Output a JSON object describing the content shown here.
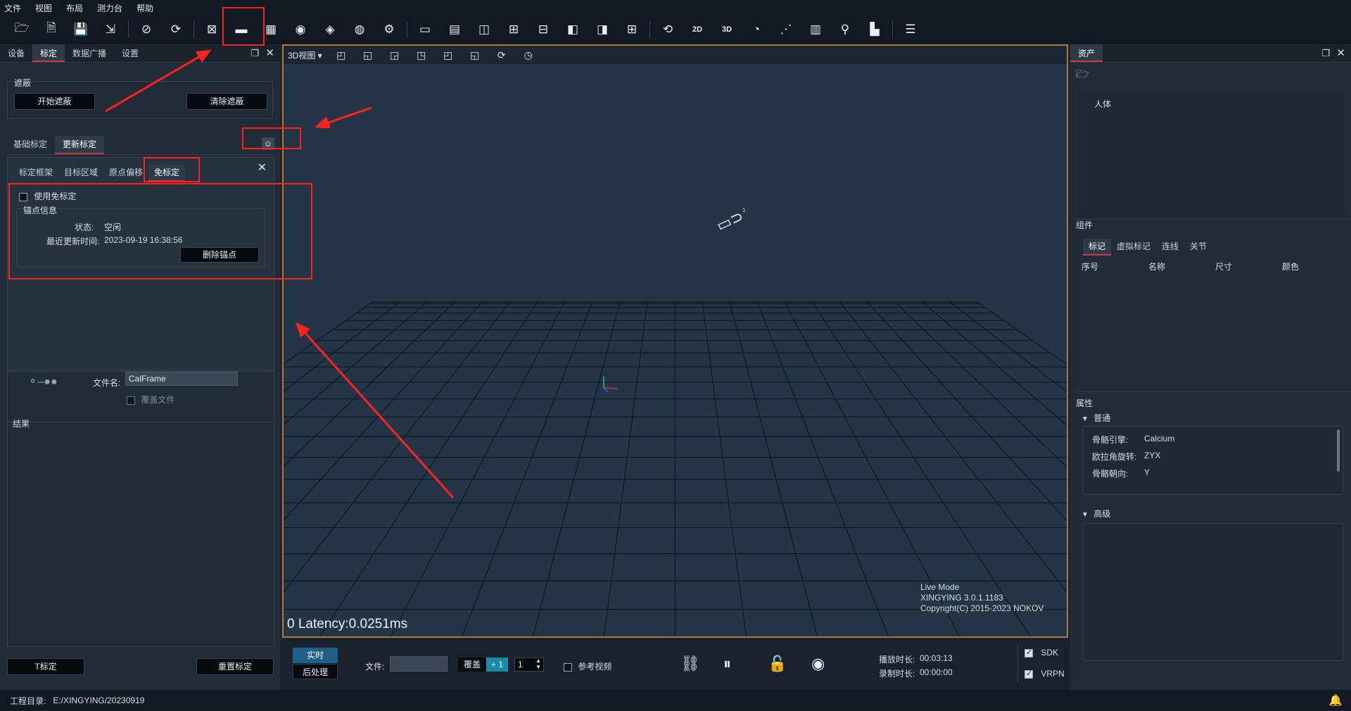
{
  "menu": [
    "文件",
    "视图",
    "布局",
    "测力台",
    "帮助"
  ],
  "toolbar_icons": [
    "open-folder-icon",
    "new-file-icon",
    "save-icon",
    "save-as-icon",
    "hide-icon",
    "refresh-icon",
    "camera-off-icon",
    "ruler-icon",
    "film-icon",
    "rotate-icon",
    "layers-icon",
    "wifi-icon",
    "settings-icon",
    "monitor-icon",
    "layout-1-icon",
    "layout-2-icon",
    "layout-3-icon",
    "layout-4-icon",
    "layout-5-icon",
    "layout-6-icon",
    "layout-7-icon",
    "screen-refresh-icon",
    "2d-icon",
    "3d-icon",
    "gauge-icon",
    "nodes-icon",
    "bar-chart-icon",
    "location-icon",
    "document-icon",
    "list-icon"
  ],
  "left_panel": {
    "tabs": [
      "设备",
      "标定",
      "数据广播",
      "设置"
    ],
    "mask_group": {
      "title": "遮蔽",
      "start_btn": "开始遮蔽",
      "clear_btn": "清除遮蔽"
    },
    "calib_tabs": [
      "基础标定",
      "更新标定"
    ],
    "sub_tabs": [
      "标定框架",
      "目标区域",
      "原点偏移",
      "免标定"
    ],
    "use_free_calib": "使用免标定",
    "anchor_group": "锚点信息",
    "status_label": "状态:",
    "status_value": "空闲",
    "last_update_label": "最近更新时间:",
    "last_update_value": "2023-09-19 16:38:56",
    "delete_anchor_btn": "删除锚点",
    "filename_label": "文件名:",
    "filename_value": "CalFrame",
    "overwrite_label": "覆盖文件",
    "results_title": "结果",
    "t_calib_btn": "T标定",
    "reset_calib_btn": "重置标定"
  },
  "viewport": {
    "view_mode": "3D视图",
    "live_mode": "Live Mode",
    "version": "XINGYING 3.0.1.1183",
    "copyright": "Copyright(C) 2015-2023 NOKOV",
    "latency": "0 Latency:0.0251ms",
    "marker_label": "1"
  },
  "right_panel": {
    "assets_tab": "资产",
    "asset_item": "人体",
    "components_title": "组件",
    "component_tabs": [
      "标记",
      "虚拟标记",
      "连线",
      "关节"
    ],
    "columns": [
      "序号",
      "名称",
      "尺寸",
      "颜色"
    ],
    "properties_title": "属性",
    "normal_section": "普通",
    "props": [
      {
        "k": "骨骼引擎:",
        "v": "Calcium"
      },
      {
        "k": "欧拉角旋转:",
        "v": "ZYX"
      },
      {
        "k": "骨骼朝向:",
        "v": "Y"
      }
    ],
    "advanced_section": "高级"
  },
  "bottom_bar": {
    "realtime_btn": "实时",
    "postprocess_btn": "后处理",
    "file_label": "文件:",
    "overwrite_tag": "覆盖",
    "plus_one": "+ 1",
    "spinner_value": "1",
    "ref_video": "参考视频",
    "play_duration_label": "播放时长:",
    "play_duration_value": "00:03:13",
    "record_duration_label": "录制时长:",
    "record_duration_value": "00:00:00",
    "sdk_label": "SDK",
    "vrpn_label": "VRPN"
  },
  "status": {
    "project_dir_label": "工程目录:",
    "project_dir_value": "E:/XINGYING/20230919"
  },
  "colors": {
    "accent_red": "#d4373c",
    "viewport_border": "#b07a35",
    "annotation_red": "#ff2020",
    "realtime_blue": "#1f5f8a",
    "plus_teal": "#1a8ba8"
  }
}
